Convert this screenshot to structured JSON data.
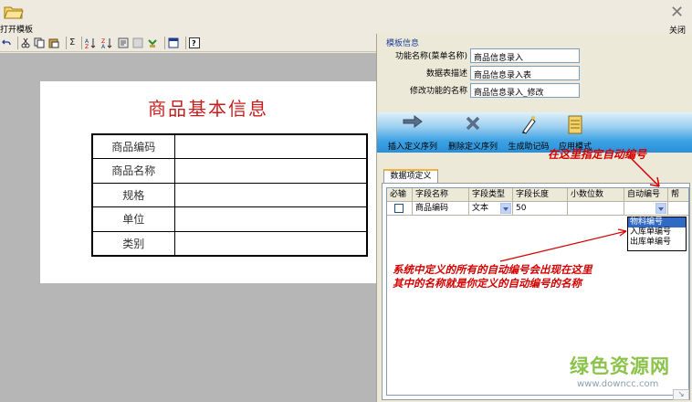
{
  "top": {
    "open_label": "打开模板",
    "close_label": "关闭"
  },
  "toolbar": {
    "sigma": "Σ",
    "help": "?"
  },
  "form": {
    "title": "商品基本信息",
    "fields": [
      "商品编码",
      "商品名称",
      "规格",
      "单位",
      "类别"
    ]
  },
  "template_info": {
    "legend": "模板信息",
    "rows": [
      {
        "label": "功能名称(菜单名称)",
        "value": "商品信息录入"
      },
      {
        "label": "数据表描述",
        "value": "商品信息录入表"
      },
      {
        "label": "修改功能的名称",
        "value": "商品信息录入_修改"
      }
    ]
  },
  "blue_toolbar": {
    "insert": "插入定义序列",
    "delete": "删除定义序列",
    "mnemonic": "生成助记码",
    "apply": "应用模式"
  },
  "tab": {
    "label": "数据项定义"
  },
  "grid": {
    "headers": [
      "必输",
      "字段名称",
      "字段类型",
      "字段长度",
      "小数位数",
      "自动编号",
      "帮"
    ],
    "row": {
      "field_name": "商品编码",
      "field_type": "文本",
      "length": "50"
    }
  },
  "autonum_options": [
    "物料编号",
    "入库单编号",
    "出库单编号"
  ],
  "callouts": {
    "top": "在这里指定自动编号",
    "bottom_line1": "系统中定义的所有的自动编号会出现在这里",
    "bottom_line2": "其中的名称就是你定义的自动编号的名称"
  },
  "watermark": {
    "main": "绿色资源网",
    "url": "www.downcc.com"
  }
}
